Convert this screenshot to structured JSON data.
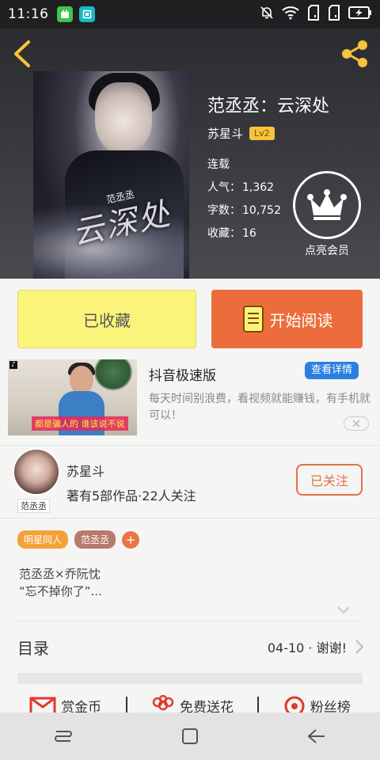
{
  "status_bar": {
    "time": "11:16"
  },
  "book": {
    "title": "范丞丞：云深处",
    "author": "苏星斗",
    "level": "Lv2",
    "status": "连载",
    "popularity_label": "人气：",
    "popularity": "1,362",
    "words_label": "字数：",
    "words": "10,752",
    "favorites_label": "收藏：",
    "favorites": "16",
    "cover_title": "云深处",
    "cover_sub": "范丞丞"
  },
  "vip": {
    "label": "点亮会员"
  },
  "actions": {
    "collected_label": "已收藏",
    "read_label": "开始阅读"
  },
  "ad": {
    "title": "抖音极速版",
    "button": "查看详情",
    "desc": "每天时间别浪费，看视频就能赚钱，有手机就可以！",
    "thumb_caption": "都是骗人的 谁该说不说"
  },
  "author_section": {
    "name": "苏星斗",
    "meta": "著有5部作品·22人关注",
    "avatar_tag": "范丞丞",
    "follow_label": "已关注"
  },
  "tags": [
    "明星同人",
    "范丞丞"
  ],
  "tag_add": "+",
  "description": {
    "line1": "范丞丞×乔阮忱",
    "line2": "“忘不掉你了”..."
  },
  "toc": {
    "label": "目录",
    "latest": "04-10 · 谢谢!"
  },
  "rewards": {
    "coin": "赏金币",
    "flower": "免费送花",
    "fans": "粉丝榜"
  },
  "colors": {
    "accent_orange": "#ec6d3b",
    "collected_yellow": "#fbf47a",
    "ad_blue": "#2b7fe0",
    "back_icon_yellow": "#f6c33c"
  }
}
